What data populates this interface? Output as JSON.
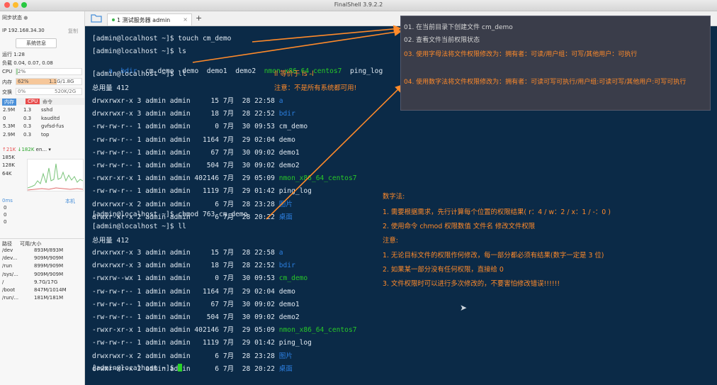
{
  "app": {
    "title": "FinalShell 3.9.2.2",
    "window_buttons": [
      "close",
      "minimize",
      "zoom"
    ],
    "colors": {
      "close": "#ff5f57",
      "minimize": "#febc2e",
      "zoom": "#28c840"
    }
  },
  "sidebar": {
    "sync_label": "同步状态",
    "ip_label": "IP 192.168.34.30",
    "copy_label": "复制",
    "sysinfo_button": "系统信息",
    "uptime": "运行 1:28",
    "load": "负载 0.04, 0.07, 0.08",
    "cpu_label": "CPU",
    "cpu_value": "2%",
    "cpu_fraction": 0.02,
    "mem_label": "内存",
    "mem_percent": "62%",
    "mem_value": "1.1G/1.8G",
    "mem_fraction": 0.62,
    "swap_label": "交换",
    "swap_percent": "0%",
    "swap_value": "520K/2G",
    "proc_headers": [
      "内存",
      "CPU",
      "命令"
    ],
    "processes": [
      {
        "mem": "2.9M",
        "cpu": "1.3",
        "cmd": "sshd"
      },
      {
        "mem": "0",
        "cpu": "0.3",
        "cmd": "kauditd"
      },
      {
        "mem": "5.3M",
        "cpu": "0.3",
        "cmd": "gvfsd-fus"
      },
      {
        "mem": "2.9M",
        "cpu": "0.3",
        "cmd": "top"
      }
    ],
    "net_up": "↑21K",
    "net_down": "↓182K",
    "net_iface": "en...",
    "net_scale": [
      "185K",
      "128K",
      "64K"
    ],
    "ping_label": "0ms",
    "ping_host": "本机",
    "ping_values": [
      "0",
      "0",
      "0"
    ],
    "disk_headers": [
      "路径",
      "可用/大小"
    ],
    "disks": [
      {
        "path": "/dev",
        "size": "893M/893M"
      },
      {
        "path": "/dev...",
        "size": "909M/909M"
      },
      {
        "path": "/run",
        "size": "899M/909M"
      },
      {
        "path": "/sys/...",
        "size": "909M/909M"
      },
      {
        "path": "/",
        "size": "9.7G/17G"
      },
      {
        "path": "/boot",
        "size": "847M/1014M"
      },
      {
        "path": "/run/...",
        "size": "181M/181M"
      }
    ]
  },
  "tabs": [
    {
      "label": "1 测试服务器 admin",
      "close": "×"
    }
  ],
  "tab_add": "+",
  "terminal": {
    "cmd1": "[admin@localhost ~]$ touch cm_demo",
    "cmd2": "[admin@localhost ~]$ ls",
    "ls_items": [
      "a",
      "bdir",
      "cm_demo",
      "demo",
      "demo1",
      "demo2",
      "nmon_x86_64_centos7",
      "ping_log"
    ],
    "cmd3": "[admin@localhost ~]$ ll",
    "total1": "总用量 412",
    "listing1": [
      {
        "perm": "drwxrwxr-x",
        "links": "3",
        "user": "admin",
        "group": "admin",
        "size": "15",
        "month": "7月",
        "day": "28",
        "time": "22:58",
        "name": "a",
        "color": "blue"
      },
      {
        "perm": "drwxrwxr-x",
        "links": "3",
        "user": "admin",
        "group": "admin",
        "size": "18",
        "month": "7月",
        "day": "28",
        "time": "22:52",
        "name": "bdir",
        "color": "blue"
      },
      {
        "perm": "-rw-rw-r--",
        "links": "1",
        "user": "admin",
        "group": "admin",
        "size": "0",
        "month": "7月",
        "day": "30",
        "time": "09:53",
        "name": "cm_demo",
        "color": "white"
      },
      {
        "perm": "-rw-rw-r--",
        "links": "1",
        "user": "admin",
        "group": "admin",
        "size": "1164",
        "month": "7月",
        "day": "29",
        "time": "02:04",
        "name": "demo",
        "color": "white"
      },
      {
        "perm": "-rw-rw-r--",
        "links": "1",
        "user": "admin",
        "group": "admin",
        "size": "67",
        "month": "7月",
        "day": "30",
        "time": "09:02",
        "name": "demo1",
        "color": "white"
      },
      {
        "perm": "-rw-rw-r--",
        "links": "1",
        "user": "admin",
        "group": "admin",
        "size": "504",
        "month": "7月",
        "day": "30",
        "time": "09:02",
        "name": "demo2",
        "color": "white"
      },
      {
        "perm": "-rwxr-xr-x",
        "links": "1",
        "user": "admin",
        "group": "admin",
        "size": "402146",
        "month": "7月",
        "day": "29",
        "time": "05:09",
        "name": "nmon_x86_64_centos7",
        "color": "green"
      },
      {
        "perm": "-rw-rw-r--",
        "links": "1",
        "user": "admin",
        "group": "admin",
        "size": "1119",
        "month": "7月",
        "day": "29",
        "time": "01:42",
        "name": "ping_log",
        "color": "white"
      },
      {
        "perm": "drwxrwxr-x",
        "links": "2",
        "user": "admin",
        "group": "admin",
        "size": "6",
        "month": "7月",
        "day": "28",
        "time": "23:28",
        "name": "图片",
        "color": "blue"
      },
      {
        "perm": "drwxr-xr-x",
        "links": "2",
        "user": "admin",
        "group": "admin",
        "size": "6",
        "month": "7月",
        "day": "28",
        "time": "20:22",
        "name": "桌面",
        "color": "blue"
      }
    ],
    "cmd4": "[admin@localhost ~]$ chmod 763 cm_demo",
    "cmd5": "[admin@localhost ~]$ ll",
    "total2": "总用量 412",
    "listing2": [
      {
        "perm": "drwxrwxr-x",
        "links": "3",
        "user": "admin",
        "group": "admin",
        "size": "15",
        "month": "7月",
        "day": "28",
        "time": "22:58",
        "name": "a",
        "color": "blue"
      },
      {
        "perm": "drwxrwxr-x",
        "links": "3",
        "user": "admin",
        "group": "admin",
        "size": "18",
        "month": "7月",
        "day": "28",
        "time": "22:52",
        "name": "bdir",
        "color": "blue"
      },
      {
        "perm": "-rwxrw--wx",
        "links": "1",
        "user": "admin",
        "group": "admin",
        "size": "0",
        "month": "7月",
        "day": "30",
        "time": "09:53",
        "name": "cm_demo",
        "color": "green"
      },
      {
        "perm": "-rw-rw-r--",
        "links": "1",
        "user": "admin",
        "group": "admin",
        "size": "1164",
        "month": "7月",
        "day": "29",
        "time": "02:04",
        "name": "demo",
        "color": "white"
      },
      {
        "perm": "-rw-rw-r--",
        "links": "1",
        "user": "admin",
        "group": "admin",
        "size": "67",
        "month": "7月",
        "day": "30",
        "time": "09:02",
        "name": "demo1",
        "color": "white"
      },
      {
        "perm": "-rw-rw-r--",
        "links": "1",
        "user": "admin",
        "group": "admin",
        "size": "504",
        "month": "7月",
        "day": "30",
        "time": "09:02",
        "name": "demo2",
        "color": "white"
      },
      {
        "perm": "-rwxr-xr-x",
        "links": "1",
        "user": "admin",
        "group": "admin",
        "size": "402146",
        "month": "7月",
        "day": "29",
        "time": "05:09",
        "name": "nmon_x86_64_centos7",
        "color": "green"
      },
      {
        "perm": "-rw-rw-r--",
        "links": "1",
        "user": "admin",
        "group": "admin",
        "size": "1119",
        "month": "7月",
        "day": "29",
        "time": "01:42",
        "name": "ping_log",
        "color": "white"
      },
      {
        "perm": "drwxrwxr-x",
        "links": "2",
        "user": "admin",
        "group": "admin",
        "size": "6",
        "month": "7月",
        "day": "28",
        "time": "23:28",
        "name": "图片",
        "color": "blue"
      },
      {
        "perm": "drwxr-xr-x",
        "links": "2",
        "user": "admin",
        "group": "admin",
        "size": "6",
        "month": "7月",
        "day": "28",
        "time": "20:22",
        "name": "桌面",
        "color": "blue"
      }
    ],
    "prompt_final": "[admin@localhost ~]$ "
  },
  "callout": {
    "line1": "01. 在当前目录下创建文件 cm_demo",
    "line2": "02. 查看文件当前权限状态",
    "line3": "03. 使用字母法将文件权限修改为：拥有者：可读/用户组：可写/其他用户：可执行",
    "line4": "04. 使用数字法将文件权限修改为：拥有者：可读可写可执行/用户组:可读可写/其他用户:可写可执行"
  },
  "notes": {
    "ll_alias": "ll 等价于 ls -l",
    "ll_warning": "注意：不是所有系统都可用!",
    "numeric_title": "数字法:",
    "numeric_1": "1. 需要根据需求，先行计算每个位置的权限结果( r：4 / w：2 / x：1 / -：0 )",
    "numeric_2": "2. 使用命令 chmod 权限数值 文件名 修改文件权限",
    "attention_title": "注意:",
    "attention_1": "1. 无论目标文件的权限作何修改，每一部分都必须有结果(数字一定是 3 位)",
    "attention_2": "2. 如果某一部分没有任何权限，直接给 0",
    "attention_3": "3. 文件权限时可以进行多次修改的，不要害怕修改错误!!!!!!"
  }
}
